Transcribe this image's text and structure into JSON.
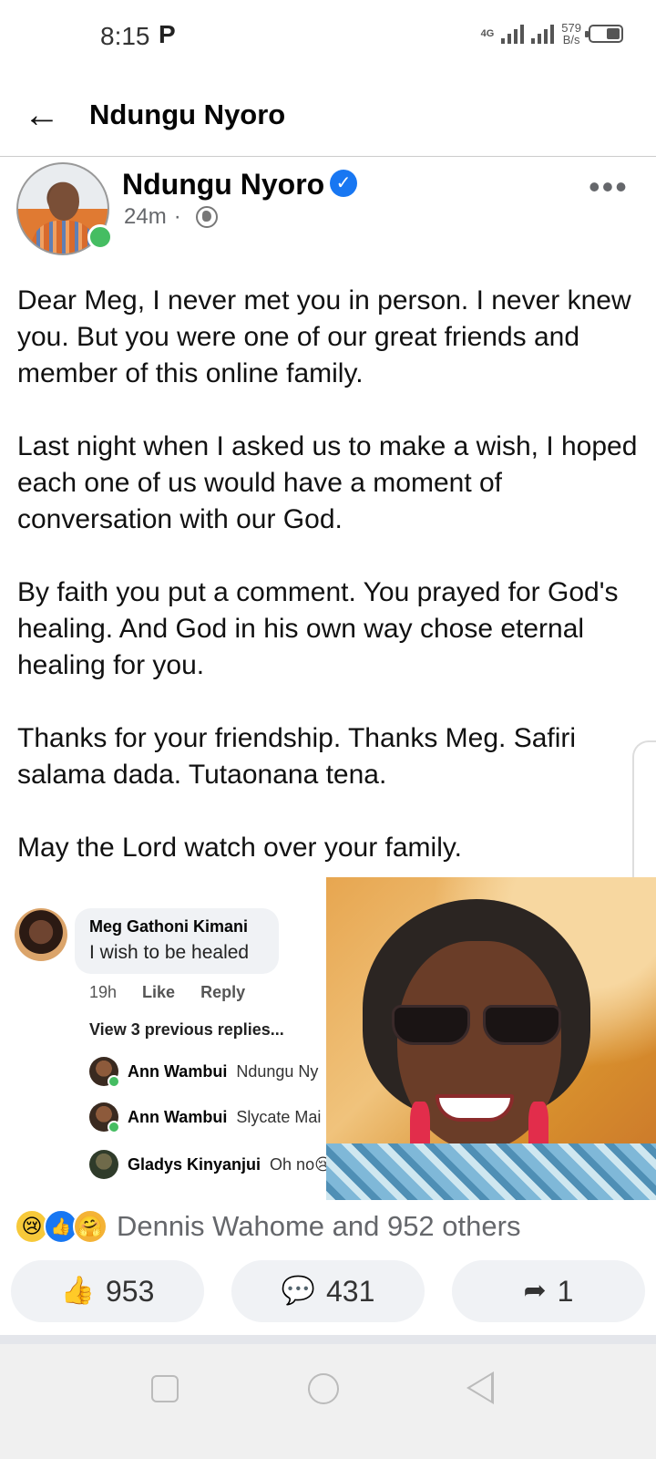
{
  "status_bar": {
    "time": "8:15",
    "notification_icon": "P",
    "network": "4G",
    "speed_value": "579",
    "speed_unit": "B/s"
  },
  "header": {
    "back_icon": "arrow-left",
    "title": "Ndungu Nyoro"
  },
  "post": {
    "author": "Ndungu Nyoro",
    "verified": true,
    "time": "24m",
    "separator": "·",
    "privacy_icon": "globe",
    "more_icon": "•••",
    "paragraphs": [
      "Dear Meg, I never met you in person. I never knew you. But you were one of our great friends and member of this online family.",
      "Last night when I asked us to make a wish, I hoped each one of us would have a moment of conversation with our God.",
      "By faith you put a comment. You prayed for God's healing. And God in his own way chose eternal healing for you.",
      "Thanks for your friendship. Thanks Meg. Safiri salama dada. Tutaonana tena.",
      "May the Lord watch over your family."
    ]
  },
  "embedded_comment": {
    "name": "Meg Gathoni Kimani",
    "text": "I wish to be healed",
    "time": "19h",
    "like": "Like",
    "reply": "Reply",
    "view_replies": "View 3 previous replies...",
    "replies": [
      {
        "name": "Ann Wambui",
        "text": "Ndungu Ny"
      },
      {
        "name": "Ann Wambui",
        "text": "Slycate Mai"
      },
      {
        "name": "Gladys Kinyanjui",
        "text": "Oh no😢"
      }
    ]
  },
  "reactions": {
    "summary": "Dennis Wahome and 952 others",
    "icons": [
      "sad-reaction",
      "like-reaction",
      "care-reaction"
    ]
  },
  "actions": {
    "like_count": "953",
    "comment_count": "431",
    "share_count": "1"
  },
  "colors": {
    "accent": "#1877f2",
    "online": "#45bd62",
    "secondary_text": "#65676b"
  }
}
